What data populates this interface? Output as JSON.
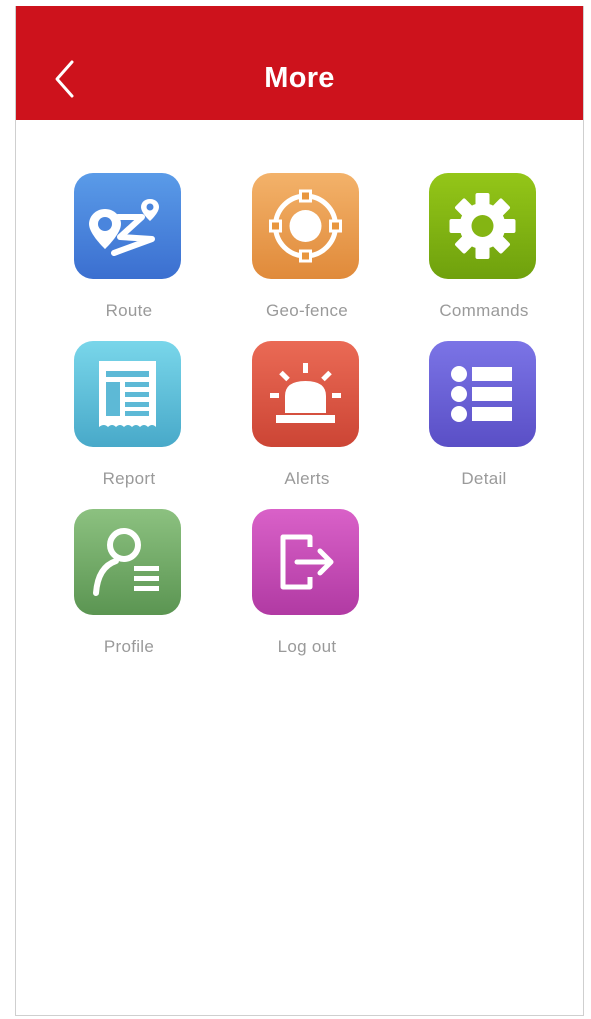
{
  "header": {
    "title": "More",
    "back_icon": "chevron-left-icon"
  },
  "menu": [
    {
      "key": "route",
      "label": "Route",
      "icon": "route-map-pin-icon",
      "color_top": "#5a9be8",
      "color_bottom": "#3b6fd0"
    },
    {
      "key": "geofence",
      "label": "Geo-fence",
      "icon": "target-icon",
      "color_top": "#f3b26a",
      "color_bottom": "#e08a3a"
    },
    {
      "key": "commands",
      "label": "Commands",
      "icon": "gear-icon",
      "color_top": "#94c618",
      "color_bottom": "#6fa10d"
    },
    {
      "key": "report",
      "label": "Report",
      "icon": "receipt-icon",
      "color_top": "#79d6ea",
      "color_bottom": "#48a9c9"
    },
    {
      "key": "alerts",
      "label": "Alerts",
      "icon": "siren-icon",
      "color_top": "#ea6a55",
      "color_bottom": "#cc4535"
    },
    {
      "key": "detail",
      "label": "Detail",
      "icon": "list-icon",
      "color_top": "#7b74e6",
      "color_bottom": "#5a4fc6"
    },
    {
      "key": "profile",
      "label": "Profile",
      "icon": "person-list-icon",
      "color_top": "#8cc180",
      "color_bottom": "#5b9552"
    },
    {
      "key": "logout",
      "label": "Log out",
      "icon": "exit-icon",
      "color_top": "#d961c8",
      "color_bottom": "#b13aa3"
    }
  ],
  "colors": {
    "appbar": "#cd121c",
    "label": "#9a9a9a"
  }
}
